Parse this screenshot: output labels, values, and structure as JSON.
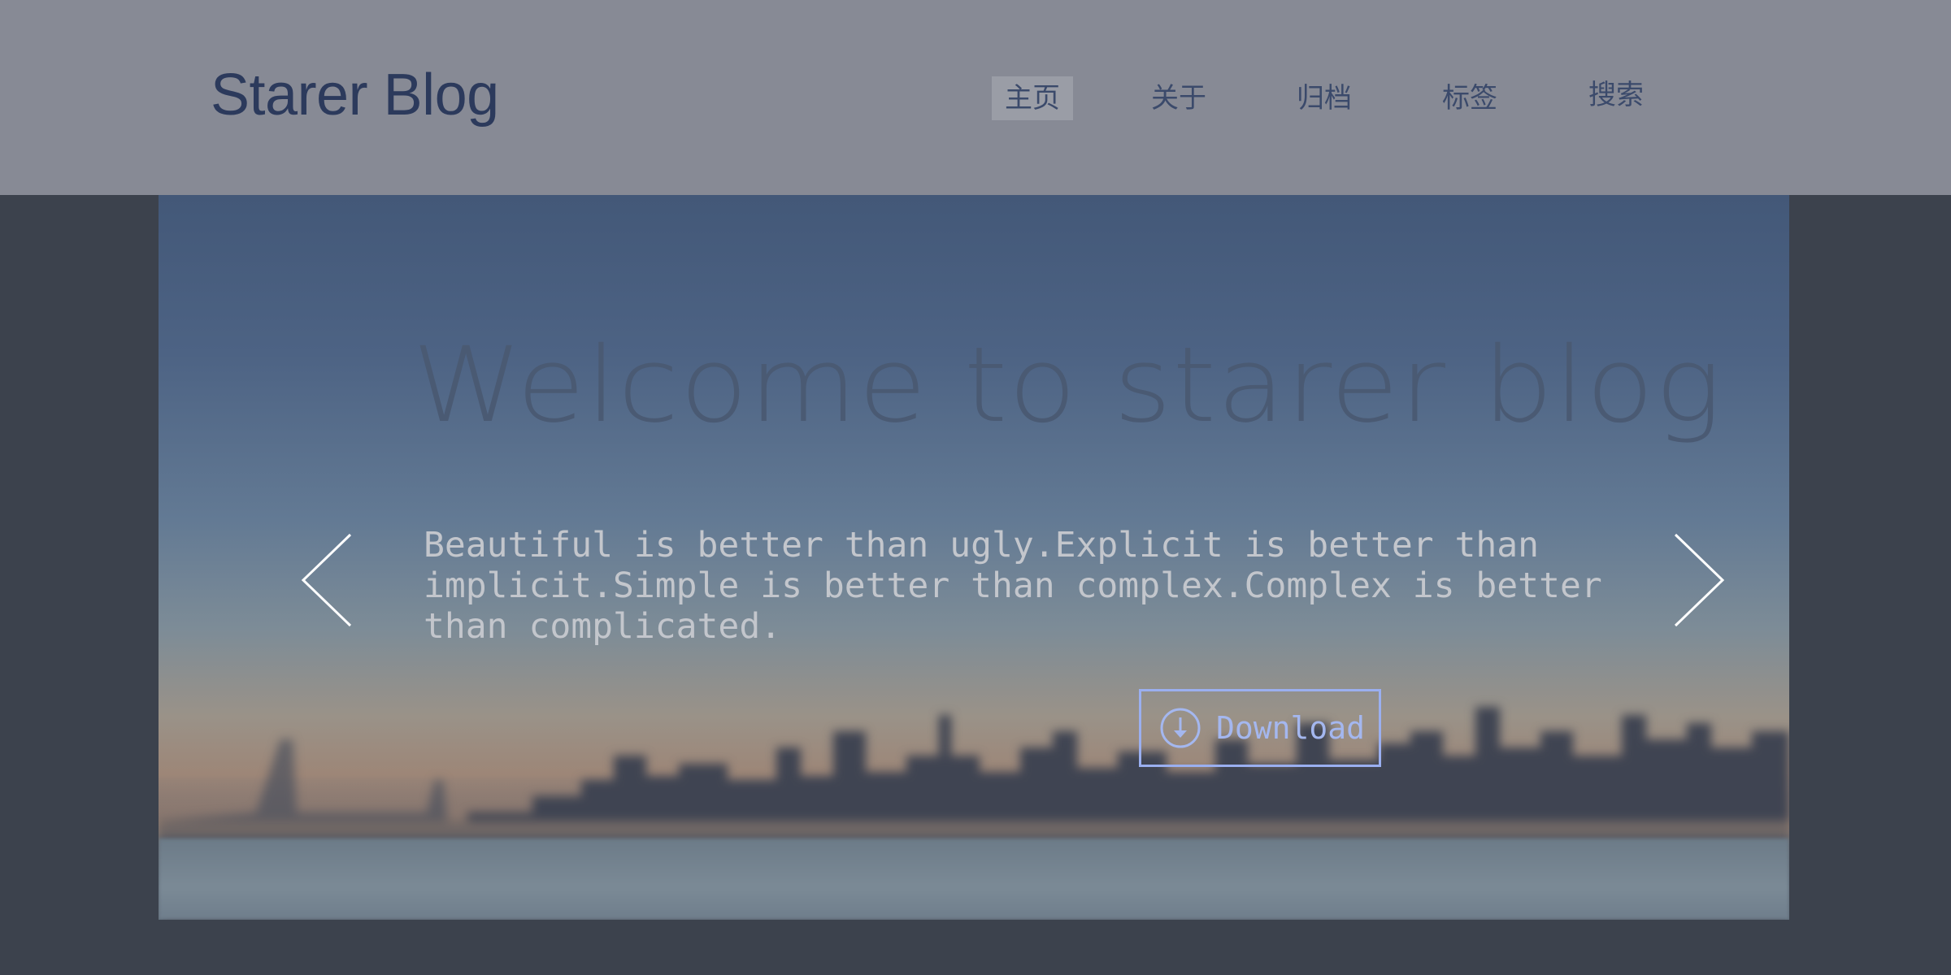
{
  "header": {
    "brand": "Starer Blog",
    "nav": [
      {
        "label": "主页",
        "active": true
      },
      {
        "label": "关于",
        "active": false
      },
      {
        "label": "归档",
        "active": false
      },
      {
        "label": "标签",
        "active": false
      },
      {
        "label": "搜索",
        "active": false
      }
    ]
  },
  "hero": {
    "title": "Welcome to starer blog",
    "text": "Beautiful is better than ugly.Explicit is better than implicit.Simple is better than complex.Complex is better than complicated.",
    "download_label": "Download",
    "prev_icon": "chevron-left-icon",
    "next_icon": "chevron-right-icon"
  },
  "colors": {
    "header_bg": "#878a95",
    "page_bg": "#3c424d",
    "brand": "#2c3a5c",
    "accent": "#9aaff0"
  }
}
